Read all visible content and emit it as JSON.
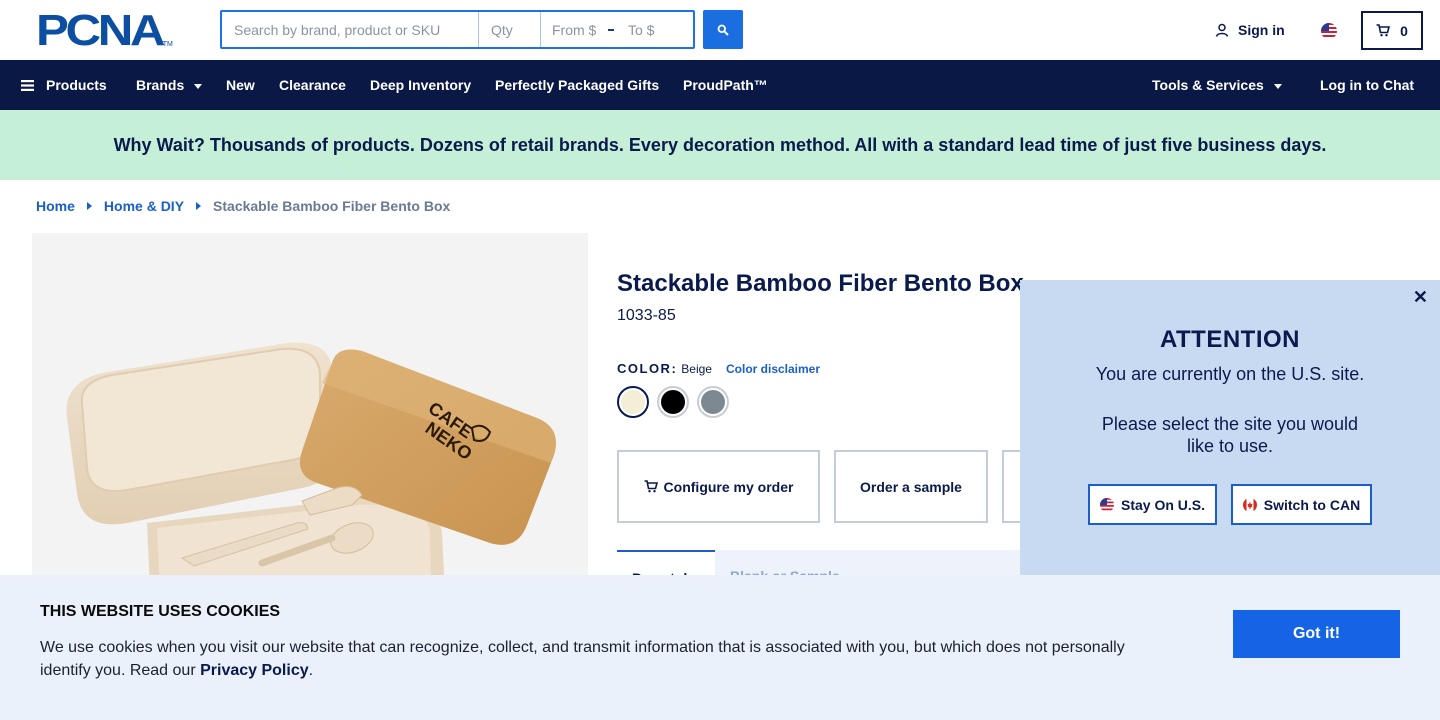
{
  "brand": {
    "logo_text": "PCNA",
    "trademark": "TM"
  },
  "search": {
    "placeholder": "Search by brand, product or SKU",
    "qty_placeholder": "Qty",
    "from_placeholder": "From $",
    "to_placeholder": "To $",
    "button_icon": "search-icon"
  },
  "header": {
    "signin_label": "Sign in",
    "signin_icon": "user-icon",
    "region_icon": "us-flag-icon",
    "cart_icon": "cart-icon",
    "cart_count": "0"
  },
  "nav": {
    "products_label": "Products",
    "brands_label": "Brands",
    "new_label": "New",
    "clearance_label": "Clearance",
    "deep_inventory_label": "Deep Inventory",
    "gifts_label": "Perfectly Packaged Gifts",
    "proudpath_label": "ProudPath™",
    "tools_label": "Tools & Services",
    "chat_label": "Log in to Chat"
  },
  "promo": {
    "text": "Why Wait? Thousands of products. Dozens of retail brands. Every decoration method. All with a standard lead time of just five business days."
  },
  "breadcrumb": {
    "home": "Home",
    "category": "Home & DIY",
    "current": "Stackable Bamboo Fiber Bento Box"
  },
  "product": {
    "title": "Stackable Bamboo Fiber Bento Box",
    "sku": "1033-85",
    "color_label": "COLOR:",
    "color_value": "Beige",
    "color_disclaimer": "Color disclaimer",
    "swatches": [
      {
        "name": "Beige",
        "hex": "#f3eed6"
      },
      {
        "name": "Black",
        "hex": "#000000"
      },
      {
        "name": "Gray",
        "hex": "#7d8992"
      }
    ],
    "imprint_text_line1": "CAFE",
    "imprint_text_line2": "NEKO",
    "actions": {
      "configure": "Configure my order",
      "sample": "Order a sample"
    },
    "tabs": {
      "tab1": "Preset d",
      "tab2": "Blank or Sample"
    }
  },
  "attention": {
    "title": "ATTENTION",
    "message1": "You are currently on the U.S. site.",
    "message2": "Please select the site you would like to use.",
    "stay_label": "Stay On U.S.",
    "switch_label": "Switch to CAN",
    "close_symbol": "✕"
  },
  "cookie": {
    "title": "THIS WEBSITE USES COOKIES",
    "text": "We use cookies when you visit our website that can recognize, collect, and transmit information that is associated with you, but which does not personally identify you. Read our ",
    "link": "Privacy Policy",
    "period": ".",
    "button": "Got it!"
  },
  "colors": {
    "navy": "#0a1846",
    "link_blue": "#1a5fc8",
    "button_blue": "#1664e6",
    "promo_green": "#c6efd7",
    "modal_bg": "#c8daf2",
    "cookie_bg": "#ebf1fa"
  }
}
